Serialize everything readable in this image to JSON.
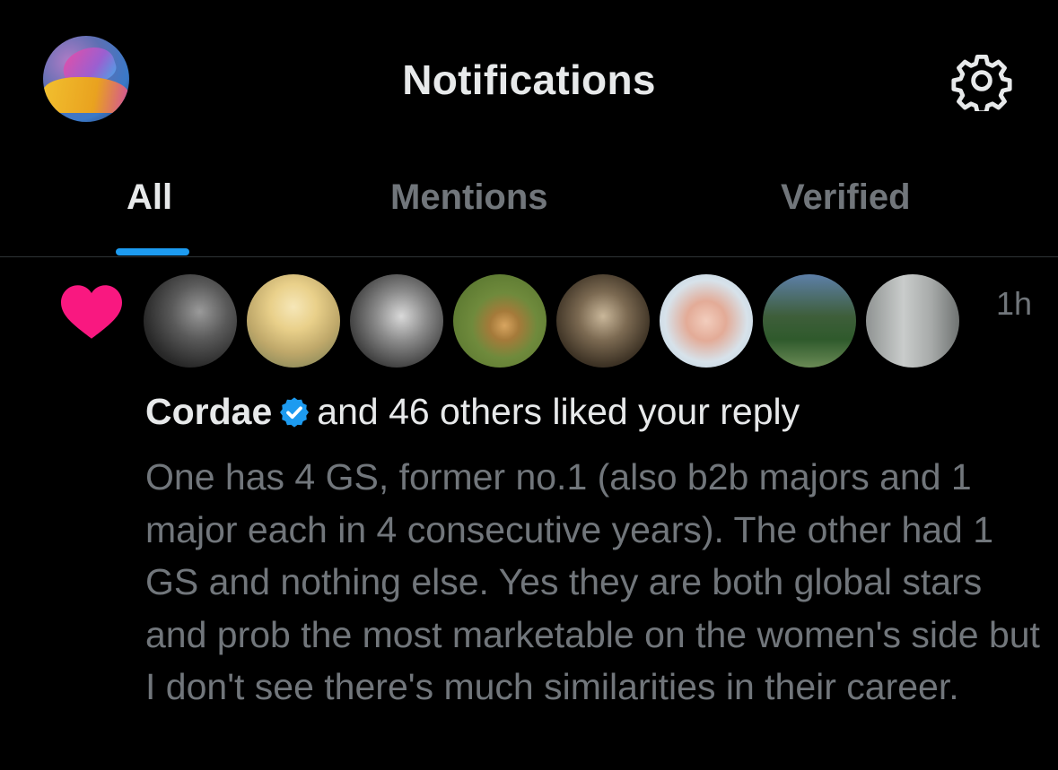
{
  "header": {
    "title": "Notifications",
    "profile_avatar_icon": "profile-avatar",
    "settings_icon": "gear-icon"
  },
  "tabs": [
    {
      "label": "All",
      "active": true
    },
    {
      "label": "Mentions",
      "active": false
    },
    {
      "label": "Verified",
      "active": false
    }
  ],
  "colors": {
    "background": "#000000",
    "primary_text": "#e7e9ea",
    "secondary_text": "#71767b",
    "accent": "#1d9bf0",
    "like": "#f91880"
  },
  "notification": {
    "type_icon": "heart-icon",
    "time": "1h",
    "actor_name": "Cordae",
    "actor_verified": true,
    "action_text": "and 46 others liked your reply",
    "reply_text": "One has 4 GS, former no.1 (also b2b majors and 1 major each in 4 consecutive years). The other had 1 GS and nothing else. Yes they are both global stars and prob the most marketable on the women's side but I  don't see there's much similarities in their career.",
    "avatars": [
      {
        "name": "liker-avatar-1"
      },
      {
        "name": "liker-avatar-2"
      },
      {
        "name": "liker-avatar-3"
      },
      {
        "name": "liker-avatar-4"
      },
      {
        "name": "liker-avatar-5"
      },
      {
        "name": "liker-avatar-6"
      },
      {
        "name": "liker-avatar-7"
      },
      {
        "name": "liker-avatar-8"
      }
    ]
  }
}
